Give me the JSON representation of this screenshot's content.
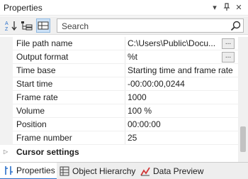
{
  "panel": {
    "title": "Properties",
    "dropdown_glyph": "▾",
    "pin_glyph": "⊥",
    "close_glyph": "✕"
  },
  "toolbar": {
    "sort_az_icon": "sort-az-icon",
    "categorized_icon": "tree-view-icon",
    "pages_icon": "property-pages-icon",
    "search_placeholder": "Search"
  },
  "properties": [
    {
      "name": "File path name",
      "value": "C:\\Users\\Public\\Docu...",
      "has_button": true
    },
    {
      "name": "Output format",
      "value": "%t",
      "has_button": true
    },
    {
      "name": "Time base",
      "value": "Starting time and frame rate",
      "has_button": false
    },
    {
      "name": "Start time",
      "value": "-00:00:00,0244",
      "has_button": false
    },
    {
      "name": "Frame rate",
      "value": "1000",
      "has_button": false
    },
    {
      "name": "Volume",
      "value": "100 %",
      "has_button": false
    },
    {
      "name": "Position",
      "value": "00:00:00",
      "has_button": false
    },
    {
      "name": "Frame number",
      "value": "25",
      "has_button": false
    }
  ],
  "ellipsis_label": "...",
  "category": {
    "label": "Cursor settings",
    "expander": "▷"
  },
  "tabs": [
    {
      "label": "Properties",
      "icon": "properties-icon",
      "active": true
    },
    {
      "label": "Object Hierarchy",
      "icon": "hierarchy-icon",
      "active": false
    },
    {
      "label": "Data Preview",
      "icon": "data-preview-icon",
      "active": false
    }
  ],
  "colors": {
    "accent": "#2a6fc9",
    "gutter": "#f2f2f2",
    "toolbar": "#f0f0f0"
  }
}
